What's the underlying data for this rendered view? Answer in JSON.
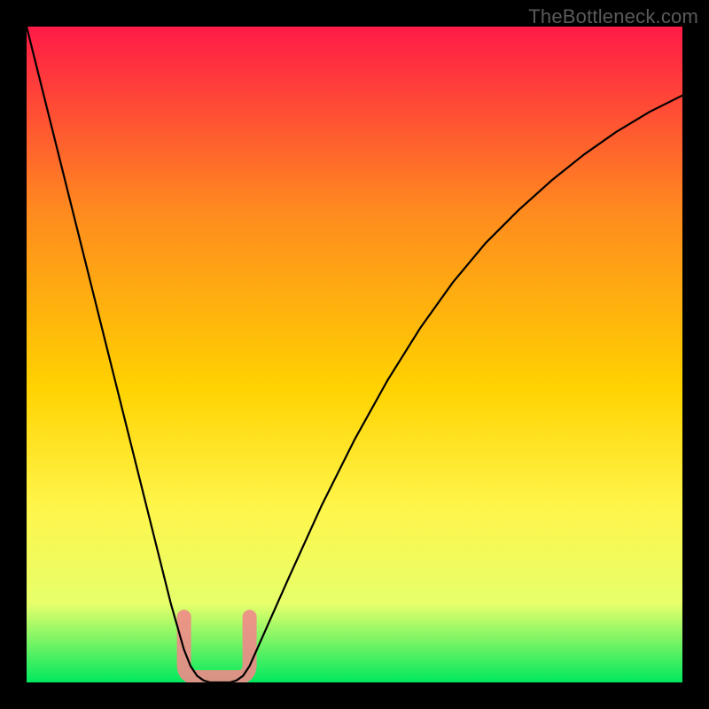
{
  "watermark": "TheBottleneck.com",
  "chart_data": {
    "type": "line",
    "title": "",
    "xlabel": "",
    "ylabel": "",
    "xlim": [
      0,
      100
    ],
    "ylim": [
      0,
      100
    ],
    "grid": false,
    "legend": false,
    "series": [
      {
        "name": "bottleneck-curve",
        "x": [
          0,
          2,
          4,
          6,
          8,
          10,
          12,
          14,
          16,
          18,
          20,
          22,
          24,
          25,
          26,
          27,
          28,
          29,
          30,
          31,
          32,
          33,
          34,
          36,
          40,
          45,
          50,
          55,
          60,
          65,
          70,
          75,
          80,
          85,
          90,
          95,
          100
        ],
        "values": [
          100,
          92,
          84,
          76,
          68,
          60,
          52,
          44,
          36,
          28,
          20,
          12,
          5,
          2.5,
          1,
          0.3,
          0,
          0,
          0,
          0,
          0.3,
          1,
          2.5,
          7,
          16,
          27,
          37,
          46,
          54,
          61,
          67,
          72,
          76.5,
          80.5,
          84,
          87,
          89.5
        ]
      }
    ],
    "optimal_marker": {
      "x_range": [
        24,
        34
      ],
      "y_top": 10
    },
    "background_gradient": {
      "top": "#ff1a47",
      "upper_mid": "#ff8a1f",
      "mid": "#ffd200",
      "lower_mid": "#fff54a",
      "near_bottom": "#e7ff6b",
      "bottom": "#00e85e"
    },
    "border_color": "#000000",
    "border_width_px": 30
  }
}
